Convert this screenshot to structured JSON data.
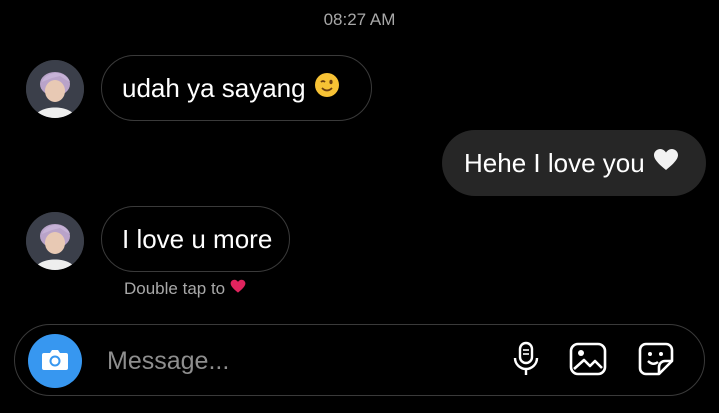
{
  "header": {
    "timestamp": "08:27 AM"
  },
  "messages": [
    {
      "direction": "incoming",
      "text": "udah ya sayang",
      "emoji": "winking-face"
    },
    {
      "direction": "outgoing",
      "text": "Hehe I love you",
      "emoji": "white-heart"
    },
    {
      "direction": "incoming",
      "text": "I love u more",
      "emoji": ""
    }
  ],
  "hint": {
    "text": "Double tap to",
    "icon": "red-heart"
  },
  "composer": {
    "placeholder": "Message...",
    "value": "",
    "accent_color": "#3797f0",
    "icons": [
      "camera-icon",
      "microphone-icon",
      "gallery-icon",
      "sticker-icon"
    ]
  }
}
